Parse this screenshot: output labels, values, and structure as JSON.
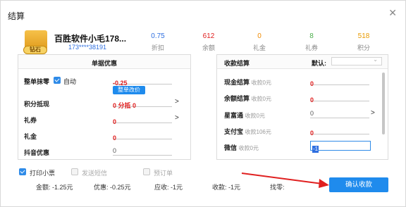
{
  "dialog": {
    "title": "结算"
  },
  "member": {
    "badge": "钻石",
    "name": "百胜软件小毛178...",
    "phone": "173****38191"
  },
  "stats": [
    {
      "value": "0.75",
      "label": "折扣",
      "color": "#2f6fe0"
    },
    {
      "value": "612",
      "label": "余额",
      "color": "#e02020"
    },
    {
      "value": "0",
      "label": "礼金",
      "color": "#f08a00"
    },
    {
      "value": "8",
      "label": "礼券",
      "color": "#4cae4c"
    },
    {
      "value": "518",
      "label": "积分",
      "color": "#e89a00"
    }
  ],
  "discount_panel": {
    "header": "单据优惠",
    "rows": {
      "rounding": {
        "label": "整单抹零",
        "auto_label": "自动",
        "value": "-0.25",
        "button": "整单改价"
      },
      "points": {
        "label": "积分抵现",
        "value": "0 分抵 0"
      },
      "coupon": {
        "label": "礼券",
        "value": "0"
      },
      "gift_money": {
        "label": "礼金",
        "value": "0"
      },
      "douyin": {
        "label": "抖音优惠",
        "value": "0"
      }
    }
  },
  "payment_panel": {
    "header": "收款结算",
    "default_label": "默认:",
    "rows": [
      {
        "label": "现金结算",
        "hint": "收款0元",
        "value": "0"
      },
      {
        "label": "余额结算",
        "hint": "收款0元",
        "value": "0"
      },
      {
        "label": "星富通",
        "hint": "收款0元",
        "value": "0"
      },
      {
        "label": "支付宝",
        "hint": "收款106元",
        "value": "0"
      },
      {
        "label": "微信",
        "hint": "收款0元",
        "value": "-1"
      }
    ]
  },
  "options": {
    "print_receipt": "打印小票",
    "send_sms": "发送短信",
    "pre_order": "预订单"
  },
  "summary": {
    "amount": "金额: -1.25元",
    "discount": "优惠: -0.25元",
    "receivable": "应收: -1元",
    "collected": "收款: -1元",
    "change": "找零:"
  },
  "confirm_button": "确认收款",
  "colors": {
    "accent": "#1f8bed",
    "danger": "#e02020"
  }
}
